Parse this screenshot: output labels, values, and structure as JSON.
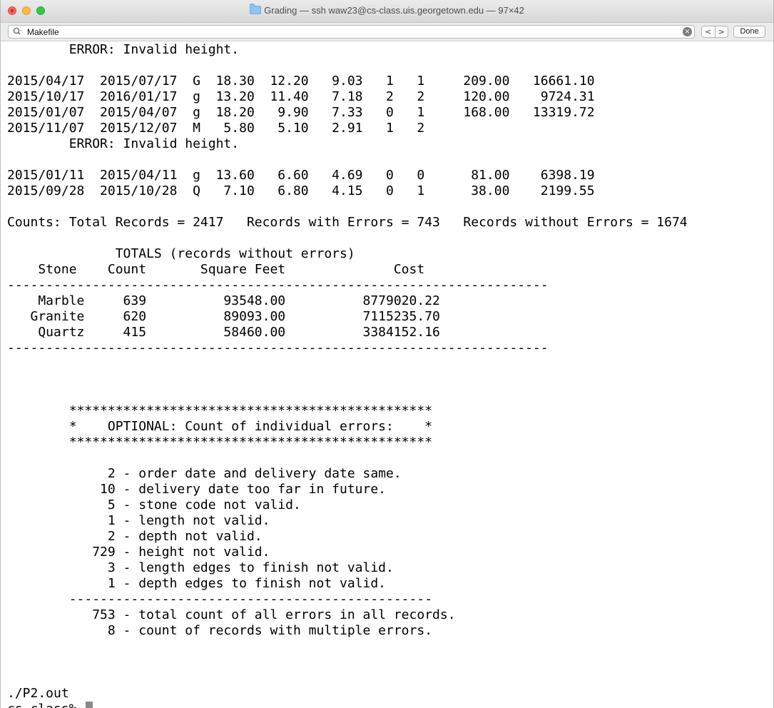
{
  "window": {
    "title": "Grading — ssh waw23@cs-class.uis.georgetown.edu — 97×42"
  },
  "findbar": {
    "search_value": "Makefile",
    "prev_label": "<",
    "next_label": ">",
    "done_label": "Done"
  },
  "terminal": {
    "lines": [
      "        ERROR: Invalid height.",
      "",
      "2015/04/17  2015/07/17  G  18.30  12.20   9.03   1   1     209.00   16661.10",
      "2015/10/17  2016/01/17  g  13.20  11.40   7.18   2   2     120.00    9724.31",
      "2015/01/07  2015/04/07  g  18.20   9.90   7.33   0   1     168.00   13319.72",
      "2015/11/07  2015/12/07  M   5.80   5.10   2.91   1   2",
      "        ERROR: Invalid height.",
      "",
      "2015/01/11  2015/04/11  g  13.60   6.60   4.69   0   0      81.00    6398.19",
      "2015/09/28  2015/10/28  Q   7.10   6.80   4.15   0   1      38.00    2199.55",
      "",
      "Counts: Total Records = 2417   Records with Errors = 743   Records without Errors = 1674",
      "",
      "              TOTALS (records without errors)",
      "    Stone    Count       Square Feet              Cost",
      "----------------------------------------------------------------------",
      "    Marble     639          93548.00          8779020.22",
      "   Granite     620          89093.00          7115235.70",
      "    Quartz     415          58460.00          3384152.16",
      "----------------------------------------------------------------------",
      "",
      "",
      "",
      "        ***********************************************",
      "        *    OPTIONAL: Count of individual errors:    *",
      "        ***********************************************",
      "",
      "             2 - order date and delivery date same.",
      "            10 - delivery date too far in future.",
      "             5 - stone code not valid.",
      "             1 - length not valid.",
      "             2 - depth not valid.",
      "           729 - height not valid.",
      "             3 - length edges to finish not valid.",
      "             1 - depth edges to finish not valid.",
      "        -----------------------------------------------",
      "           753 - total count of all errors in all records.",
      "             8 - count of records with multiple errors.",
      "",
      "",
      "",
      "./P2.out"
    ],
    "prompt": "cs-class% "
  }
}
